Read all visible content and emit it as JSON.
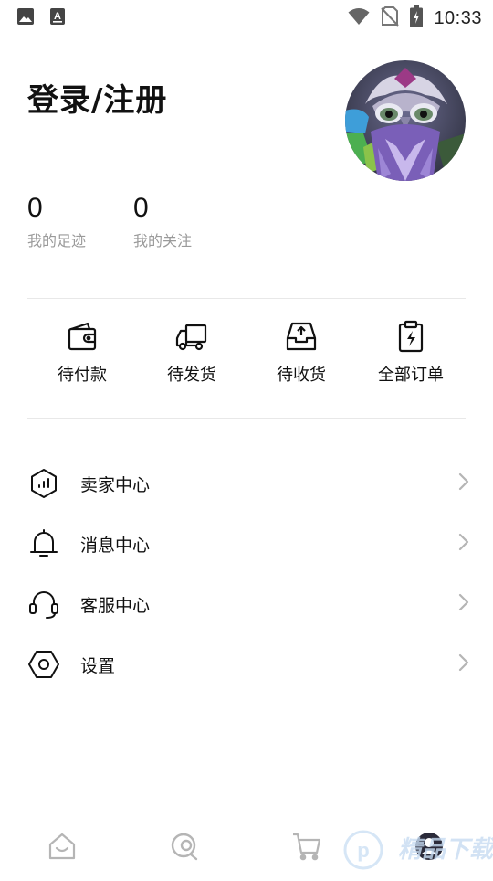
{
  "status_bar": {
    "time": "10:33",
    "icons": [
      "image-icon",
      "keyboard-a-icon",
      "wifi-icon",
      "no-sim-icon",
      "battery-charging-icon"
    ]
  },
  "header": {
    "login_label": "登录/注册",
    "avatar": "owl-graffiti-avatar"
  },
  "stats": [
    {
      "value": "0",
      "label": "我的足迹"
    },
    {
      "value": "0",
      "label": "我的关注"
    }
  ],
  "orders": [
    {
      "label": "待付款",
      "icon": "wallet-icon"
    },
    {
      "label": "待发货",
      "icon": "truck-icon"
    },
    {
      "label": "待收货",
      "icon": "inbox-upload-icon"
    },
    {
      "label": "全部订单",
      "icon": "clipboard-bolt-icon"
    }
  ],
  "menu": [
    {
      "label": "卖家中心",
      "icon": "hexagon-chart-icon"
    },
    {
      "label": "消息中心",
      "icon": "bell-icon"
    },
    {
      "label": "客服中心",
      "icon": "headset-icon"
    },
    {
      "label": "设置",
      "icon": "hexagon-settings-icon"
    }
  ],
  "bottom_nav": [
    {
      "icon": "home-icon"
    },
    {
      "icon": "discover-icon"
    },
    {
      "icon": "cart-icon"
    },
    {
      "icon": "profile-icon"
    }
  ],
  "colors": {
    "text": "#111111",
    "muted": "#9a9a9a",
    "divider": "#e8e8e8",
    "nav_inactive": "#b5b5b5",
    "watermark": "#2f7fd6"
  }
}
